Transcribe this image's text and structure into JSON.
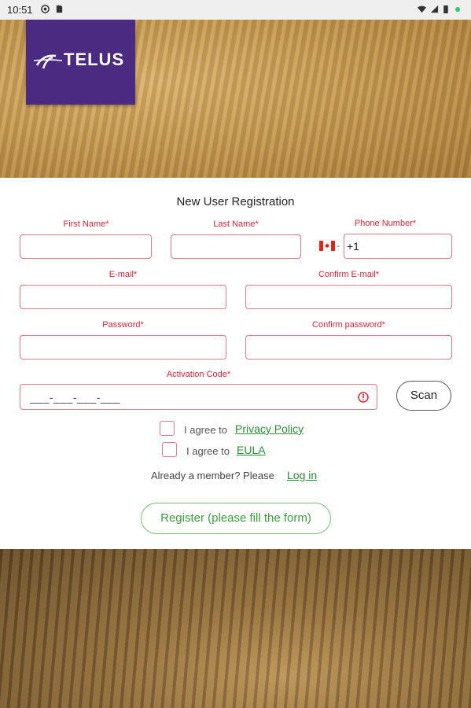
{
  "statusbar": {
    "time": "10:51"
  },
  "brand": {
    "name": "TELUS",
    "color": "#4b2a82"
  },
  "form": {
    "title": "New User Registration",
    "first_name_label": "First Name*",
    "last_name_label": "Last Name*",
    "phone_label": "Phone Number*",
    "phone_country_code": "+1",
    "phone_dash": "-",
    "email_label": "E-mail*",
    "confirm_email_label": "Confirm E-mail*",
    "password_label": "Password*",
    "confirm_password_label": "Confirm password*",
    "activation_label": "Activation Code*",
    "activation_mask": "___-___-___-___",
    "scan_label": "Scan",
    "agree1_prefix": "I agree to",
    "agree1_link": "Privacy Policy",
    "agree2_prefix": "I agree to",
    "agree2_link": "EULA",
    "member_text": "Already a member? Please",
    "login_link": "Log in",
    "register_label": "Register (please fill the form)"
  },
  "colors": {
    "error_red": "#d0283a",
    "link_green": "#2e8b3a",
    "logo_purple": "#4b2a82"
  },
  "icons": [
    "wifi-icon",
    "signal-icon",
    "battery-icon",
    "canada-flag-icon",
    "error-icon"
  ]
}
